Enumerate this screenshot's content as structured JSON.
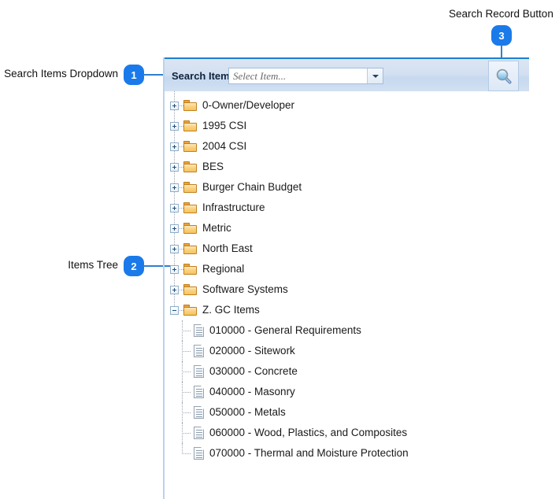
{
  "annotations": [
    {
      "label": "Search Items Dropdown",
      "number": "1"
    },
    {
      "label": "Items Tree",
      "number": "2"
    },
    {
      "label": "Search Record Button",
      "number": "3"
    }
  ],
  "toolbar": {
    "search_items_label": "Search Items",
    "combo_value": "",
    "combo_placeholder": "Select Item...",
    "dropdown_icon": "chevron-down-icon",
    "search_button_icon": "magnifier-icon"
  },
  "tree": {
    "folders": [
      {
        "label": "0-Owner/Developer",
        "state": "collapsed"
      },
      {
        "label": "1995 CSI",
        "state": "collapsed"
      },
      {
        "label": "2004 CSI",
        "state": "collapsed"
      },
      {
        "label": "BES",
        "state": "collapsed"
      },
      {
        "label": "Burger Chain Budget",
        "state": "collapsed"
      },
      {
        "label": "Infrastructure",
        "state": "collapsed"
      },
      {
        "label": "Metric",
        "state": "collapsed"
      },
      {
        "label": "North East",
        "state": "collapsed"
      },
      {
        "label": "Regional",
        "state": "collapsed"
      },
      {
        "label": "Software Systems",
        "state": "collapsed"
      },
      {
        "label": "Z. GC Items",
        "state": "expanded"
      }
    ],
    "children": [
      {
        "label": "010000 - General Requirements"
      },
      {
        "label": "020000 - Sitework"
      },
      {
        "label": "030000 - Concrete"
      },
      {
        "label": "040000 - Masonry"
      },
      {
        "label": "050000 - Metals"
      },
      {
        "label": "060000 - Wood, Plastics, and Composites"
      },
      {
        "label": "070000 - Thermal and Moisture Protection"
      }
    ]
  },
  "colors": {
    "badge": "#1a7aea",
    "leader": "#2f7fd1",
    "toolbar_top_border": "#1c7fd0",
    "folder": "#f6c35c"
  }
}
